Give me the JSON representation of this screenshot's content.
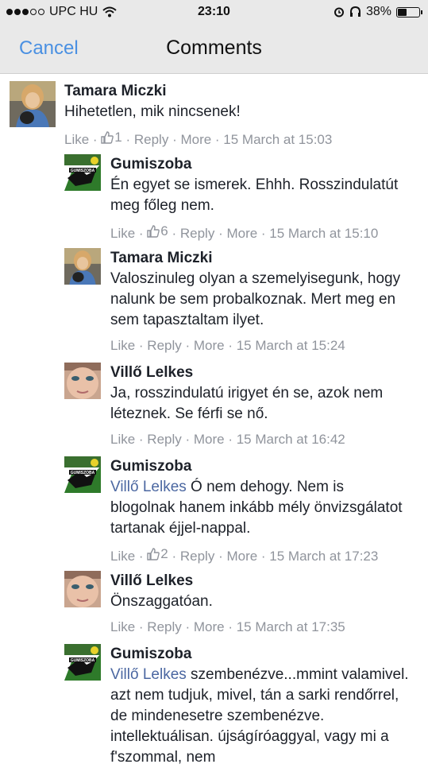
{
  "status": {
    "carrier": "UPC HU",
    "time": "23:10",
    "battery": "38%",
    "battery_level": 0.38
  },
  "nav": {
    "cancel": "Cancel",
    "title": "Comments"
  },
  "meta_labels": {
    "like": "Like",
    "reply": "Reply",
    "more": "More",
    "sep": "·"
  },
  "comments": [
    {
      "author": "Tamara Miczki",
      "mention": "",
      "text": "Hihetetlen, mik nincsenek!",
      "likes": "1",
      "time": "15 March at 15:03"
    },
    {
      "author": "Gumiszoba",
      "mention": "",
      "text": "Én egyet se ismerek. Ehhh. Rosszindulatút meg főleg nem.",
      "likes": "6",
      "time": "15 March at 15:10"
    },
    {
      "author": "Tamara Miczki",
      "mention": "",
      "text": "Valoszinuleg olyan a szemelyisegunk, hogy nalunk be sem probalkoznak. Mert meg en sem tapasztaltam ilyet.",
      "likes": "",
      "time": "15 March at 15:24"
    },
    {
      "author": "Villő Lelkes",
      "mention": "",
      "text": "Ja, rosszindulatú irigyet én se, azok nem léteznek. Se férfi se nő.",
      "likes": "",
      "time": "15 March at 16:42"
    },
    {
      "author": "Gumiszoba",
      "mention": "Villő Lelkes",
      "text": "Ó nem dehogy. Nem is blogolnak hanem inkább mély önvizsgálatot tartanak éjjel-nappal.",
      "likes": "2",
      "time": "15 March at 17:23"
    },
    {
      "author": "Villő Lelkes",
      "mention": "",
      "text": "Önszaggatóan.",
      "likes": "",
      "time": "15 March at 17:35"
    },
    {
      "author": "Gumiszoba",
      "mention": "Villő Lelkes",
      "text": "szembenézve...mmint valamivel. azt nem tudjuk, mivel, tán a sarki rendőrrel, de mindenesetre szembenézve. intellektuálisan. újságíróaggyal, vagy mi a f'szommal, nem",
      "likes": "",
      "time": ""
    }
  ],
  "logo_text": "GUMISZOBA"
}
